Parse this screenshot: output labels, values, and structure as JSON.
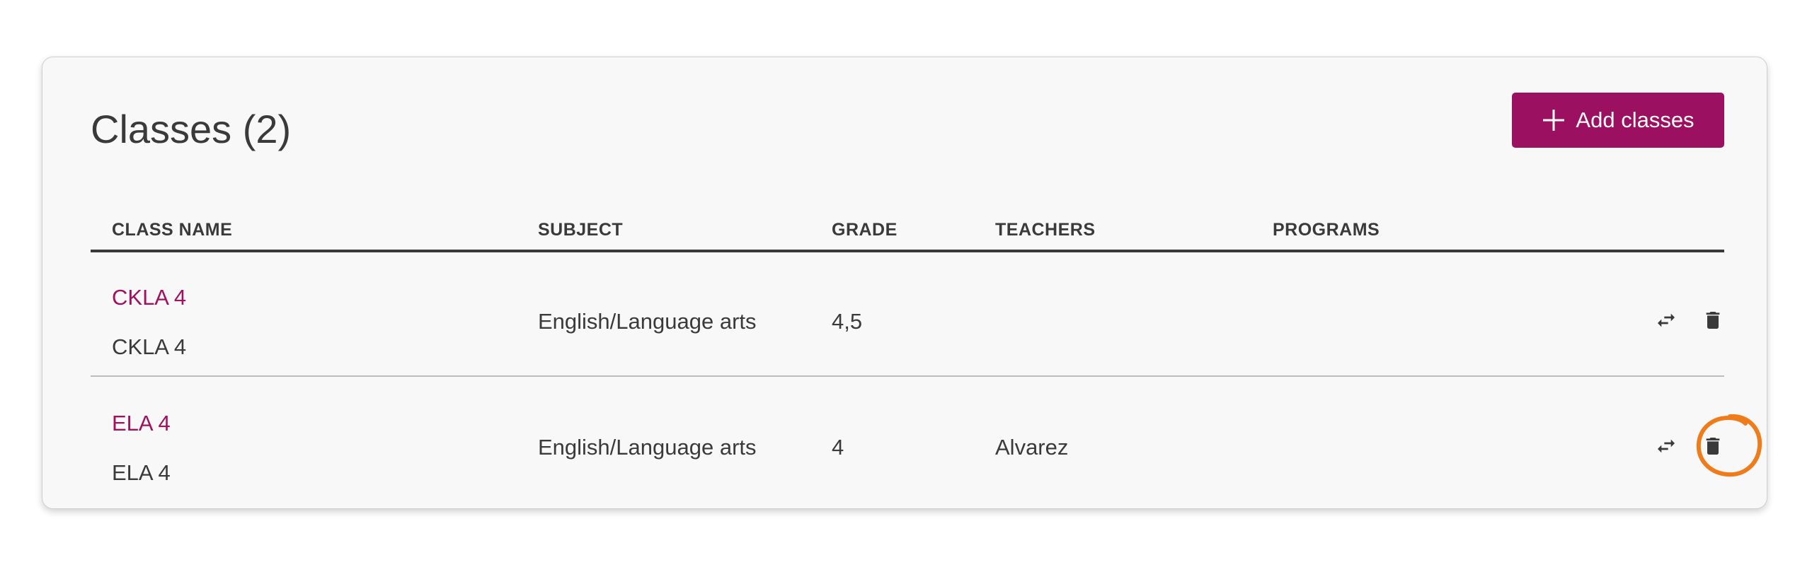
{
  "panel": {
    "title": "Classes (2)",
    "add_button_label": "Add classes"
  },
  "table": {
    "headers": [
      "CLASS NAME",
      "SUBJECT",
      "GRADE",
      "TEACHERS",
      "PROGRAMS"
    ],
    "rows": [
      {
        "class_link": "CKLA 4",
        "class_subtitle": "CKLA 4",
        "subject": "English/Language arts",
        "grade": "4,5",
        "teachers": "",
        "programs": ""
      },
      {
        "class_link": "ELA 4",
        "class_subtitle": "ELA 4",
        "subject": "English/Language arts",
        "grade": "4",
        "teachers": "Alvarez",
        "programs": ""
      }
    ]
  },
  "icons": {
    "add": "plus-icon",
    "transfer": "swap-arrows-icon",
    "delete": "trash-icon"
  },
  "colors": {
    "accent": "#9c1062",
    "link": "#a0125f",
    "highlight_annotation": "#f07b1a",
    "card_background": "#f8f8f8",
    "text": "#3a3a3a"
  }
}
